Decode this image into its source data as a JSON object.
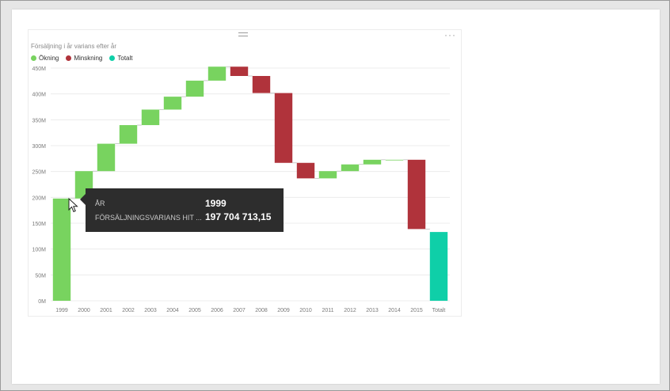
{
  "visual": {
    "title": "Försäljning i år varians efter år",
    "more_glyph": "···"
  },
  "legend": [
    {
      "label": "Ökning",
      "color": "#78d35f"
    },
    {
      "label": "Minskning",
      "color": "#b0333b"
    },
    {
      "label": "Totalt",
      "color": "#0fcfa8"
    }
  ],
  "colors": {
    "increase": "#78d35f",
    "decrease": "#b0333b",
    "total": "#0fcfa8",
    "gridline": "#ececec",
    "axis_text": "#7a7a7a",
    "tooltip_bg": "#2d2d2d"
  },
  "tooltip": {
    "row1_label": "ÅR",
    "row1_value": "1999",
    "row2_label": "FÖRSÄLJNINGSVARIANS HIT ...",
    "row2_value": "197 704 713,15"
  },
  "chart_data": {
    "type": "bar",
    "subtype": "waterfall",
    "title": "Försäljning i år varians efter år",
    "categories": [
      "1999",
      "2000",
      "2001",
      "2002",
      "2003",
      "2004",
      "2005",
      "2006",
      "2007",
      "2008",
      "2009",
      "2010",
      "2011",
      "2012",
      "2013",
      "2014",
      "2015",
      "Totalt"
    ],
    "series": [
      {
        "name": "Försäljning i år varians",
        "values": [
          197.7,
          53,
          53,
          36,
          30,
          25,
          31,
          27,
          -18,
          -33,
          -135,
          -30,
          14,
          13,
          9,
          0,
          -134,
          133
        ]
      }
    ],
    "kinds": [
      "increase",
      "increase",
      "increase",
      "increase",
      "increase",
      "increase",
      "increase",
      "increase",
      "decrease",
      "decrease",
      "decrease",
      "decrease",
      "increase",
      "increase",
      "increase",
      "increase",
      "decrease",
      "total"
    ],
    "unit": "M",
    "y_ticks": [
      "0M",
      "50M",
      "100M",
      "150M",
      "200M",
      "250M",
      "300M",
      "350M",
      "400M",
      "450M"
    ],
    "ylim": [
      0,
      450
    ],
    "grid": true,
    "legend_position": "top-left"
  }
}
